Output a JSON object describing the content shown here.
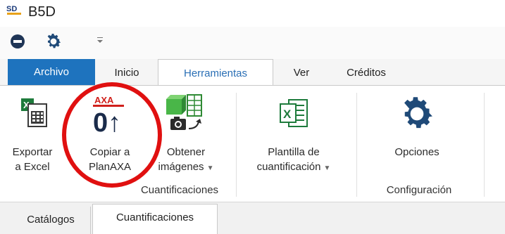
{
  "window": {
    "app_logo_text": "SD",
    "title": "B5D"
  },
  "quick_access": {
    "items": [
      {
        "icon": "minus-circle-icon"
      },
      {
        "icon": "gear-icon"
      },
      {
        "icon": "customize-dropdown-icon"
      }
    ]
  },
  "tabs": [
    {
      "label": "Archivo"
    },
    {
      "label": "Inicio"
    },
    {
      "label": "Herramientas",
      "active": true
    },
    {
      "label": "Ver"
    },
    {
      "label": "Créditos"
    }
  ],
  "ribbon": {
    "groups": [
      {
        "label": "Cuantificaciones",
        "buttons": [
          {
            "line1": "Exportar",
            "line2": "a Excel",
            "icon": "excel-export-icon"
          },
          {
            "line1": "Copiar a",
            "line2": "PlanAXA",
            "icon": "planaxa-copy-icon",
            "logo_text": "AXA",
            "glyph": "0↑"
          },
          {
            "line1": "Obtener",
            "line2": "imágenes",
            "icon": "get-images-icon",
            "has_dropdown": true
          },
          {
            "line1": "Plantilla de",
            "line2": "cuantificación",
            "icon": "excel-template-icon",
            "has_dropdown": true
          }
        ]
      },
      {
        "label": "Configuración",
        "buttons": [
          {
            "line1": "Opciones",
            "icon": "gear-icon"
          }
        ]
      }
    ]
  },
  "bottom_tabs": [
    {
      "label": "Catálogos"
    },
    {
      "label": "Cuantificaciones",
      "active": true
    }
  ],
  "colors": {
    "accent": "#1e73be",
    "active_tab_text": "#2a6fb5",
    "excel_green": "#1e7b3c",
    "highlight": "#e01010",
    "gear": "#1f4a78"
  }
}
